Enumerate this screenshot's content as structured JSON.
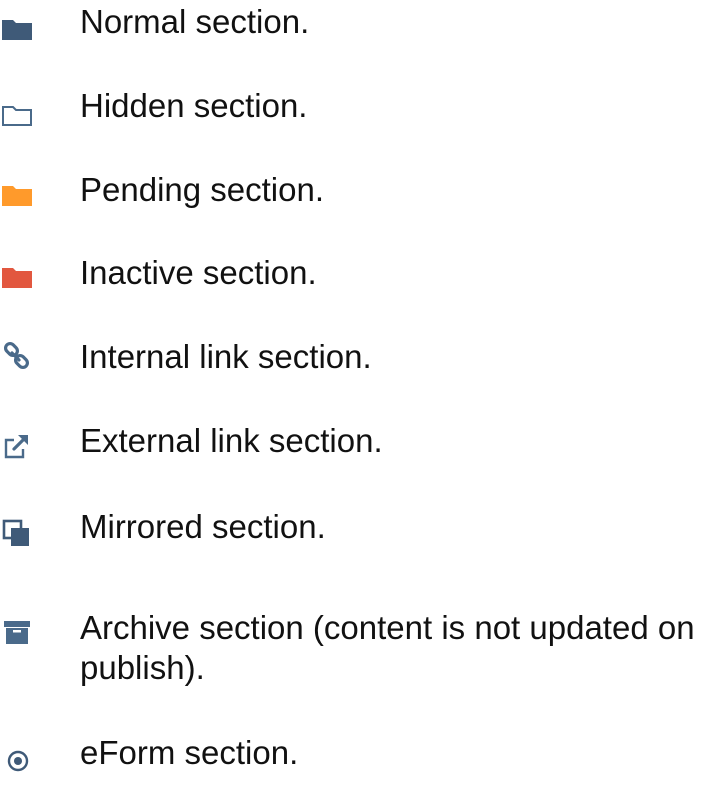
{
  "legend": {
    "items": [
      {
        "icon": "folder-filled-icon",
        "color": "#3f5a78",
        "label": "Normal section."
      },
      {
        "icon": "folder-outline-icon",
        "color": "#4a6a8a",
        "label": "Hidden section."
      },
      {
        "icon": "folder-filled-icon",
        "color": "#ff9a2b",
        "label": "Pending section."
      },
      {
        "icon": "folder-filled-icon",
        "color": "#e2573f",
        "label": "Inactive section."
      },
      {
        "icon": "chain-link-icon",
        "color": "#4a6a8a",
        "label": "Internal link section."
      },
      {
        "icon": "external-link-icon",
        "color": "#4a6a8a",
        "label": "External link section."
      },
      {
        "icon": "mirror-squares-icon",
        "color": "#3f5a78",
        "label": "Mirrored section."
      },
      {
        "icon": "archive-box-icon",
        "color": "#4a6a8a",
        "label": "Archive section (content is not updated on publish)."
      },
      {
        "icon": "eform-circle-icon",
        "color": "#3f5a78",
        "label": "eForm section."
      }
    ]
  }
}
